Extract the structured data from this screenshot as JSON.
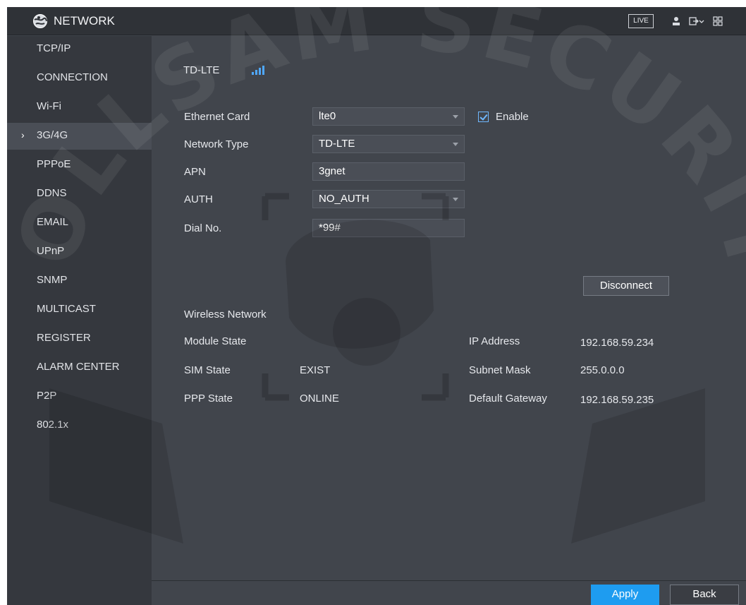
{
  "app": {
    "title": "NETWORK",
    "logo_icon": "network-globe-icon"
  },
  "toolbar": {
    "live_label": "LIVE",
    "user_icon": "user-icon",
    "logout_icon": "logout-icon",
    "menu_icon": "grid-menu-icon"
  },
  "sidebar": {
    "items": [
      {
        "label": "TCP/IP",
        "active": false
      },
      {
        "label": "CONNECTION",
        "active": false
      },
      {
        "label": "Wi-Fi",
        "active": false
      },
      {
        "label": "3G/4G",
        "active": true
      },
      {
        "label": "PPPoE",
        "active": false
      },
      {
        "label": "DDNS",
        "active": false
      },
      {
        "label": "EMAIL",
        "active": false
      },
      {
        "label": "UPnP",
        "active": false
      },
      {
        "label": "SNMP",
        "active": false
      },
      {
        "label": "MULTICAST",
        "active": false
      },
      {
        "label": "REGISTER",
        "active": false
      },
      {
        "label": "ALARM CENTER",
        "active": false
      },
      {
        "label": "P2P",
        "active": false
      },
      {
        "label": "802.1x",
        "active": false
      }
    ]
  },
  "main": {
    "signal_label": "TD-LTE",
    "signal_strength": "4 of 4 bars",
    "form": {
      "ethernet_card_label": "Ethernet Card",
      "ethernet_card_value": "lte0",
      "enable_label": "Enable",
      "enable_checked": true,
      "network_type_label": "Network Type",
      "network_type_value": "TD-LTE",
      "apn_label": "APN",
      "apn_value": "3gnet",
      "auth_label": "AUTH",
      "auth_value": "NO_AUTH",
      "dial_label": "Dial No.",
      "dial_value": "*99#"
    },
    "disconnect_label": "Disconnect",
    "wireless": {
      "heading": "Wireless Network",
      "module_state_label": "Module State",
      "module_state_value": "",
      "sim_state_label": "SIM State",
      "sim_state_value": "EXIST",
      "ppp_state_label": "PPP State",
      "ppp_state_value": "ONLINE",
      "ip_label": "IP Address",
      "ip_value": "192.168.59.234",
      "subnet_label": "Subnet Mask",
      "subnet_value": "255.0.0.0",
      "gateway_label": "Default Gateway",
      "gateway_value": "192.168.59.235"
    }
  },
  "footer": {
    "apply_label": "Apply",
    "back_label": "Back"
  },
  "watermark": {
    "text": "DOLLSAM SECURITY"
  },
  "colors": {
    "accent": "#1e9cf0",
    "signal": "#4fa8ff",
    "background": "#41454c",
    "sidebar": "#35383e"
  }
}
